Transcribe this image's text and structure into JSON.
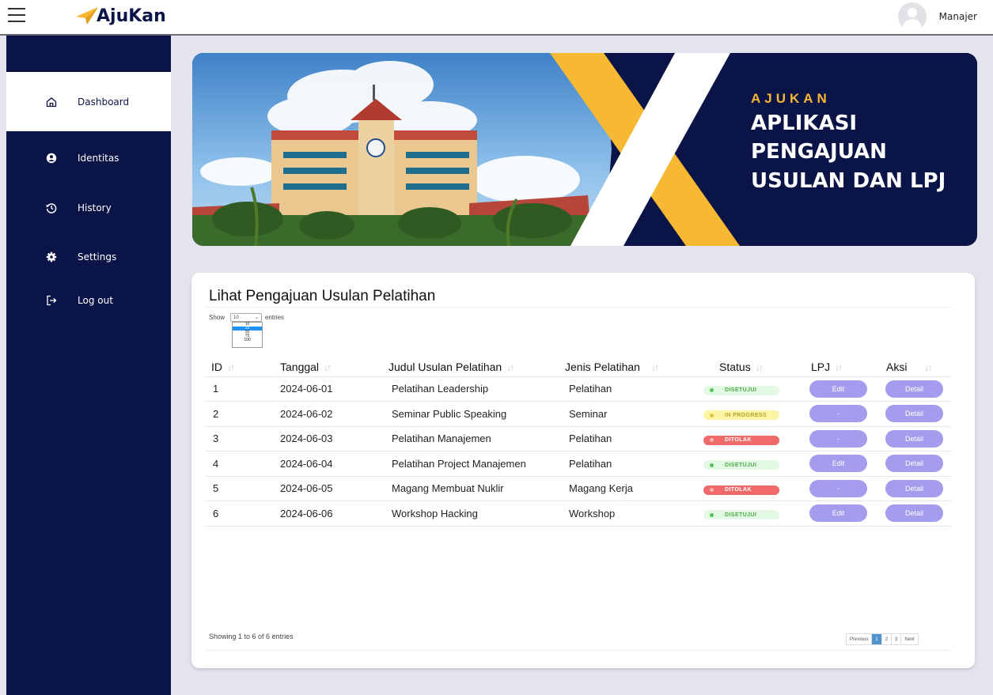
{
  "app": {
    "brand": "AjuKan",
    "user_name": "Manajer"
  },
  "colors": {
    "navy": "#0b1446",
    "accent_yellow": "#f7b834",
    "button_purple": "#a49dee"
  },
  "sidebar": {
    "items": [
      {
        "label": "Dashboard",
        "icon": "home-icon"
      },
      {
        "label": "Identitas",
        "icon": "user-circle-icon"
      },
      {
        "label": "History",
        "icon": "history-icon"
      },
      {
        "label": "Settings",
        "icon": "gear-icon"
      },
      {
        "label": "Log out",
        "icon": "logout-icon"
      }
    ]
  },
  "banner": {
    "kicker": "AJUKAN",
    "line1": "APLIKASI",
    "line2": "PENGAJUAN",
    "line3": "USULAN DAN LPJ"
  },
  "card": {
    "title": "Lihat Pengajuan Usulan Pelatihan",
    "show_label": "Show",
    "entries_label": "entries",
    "page_size": "10",
    "page_size_options": [
      "10",
      "25",
      "50",
      "75",
      "100"
    ],
    "showing_text": "Showing 1 to 6 of 6 entries"
  },
  "table": {
    "headers": [
      "ID",
      "Tanggal",
      "Judul Usulan Pelatihan",
      "Jenis Pelatihan",
      "Status",
      "LPJ",
      "Aksi"
    ],
    "rows": [
      {
        "id": "1",
        "date": "2024-06-01",
        "title": "Pelatihan Leadership",
        "type": "Pelatihan",
        "status": "DISETUJUI",
        "lpj": "Edit",
        "action": "Detail"
      },
      {
        "id": "2",
        "date": "2024-06-02",
        "title": "Seminar Public Speaking",
        "type": "Seminar",
        "status": "IN PROGRESS",
        "lpj": "-",
        "action": "Detail"
      },
      {
        "id": "3",
        "date": "2024-06-03",
        "title": "Pelatihan Manajemen",
        "type": "Pelatihan",
        "status": "DITOLAK",
        "lpj": "-",
        "action": "Detail"
      },
      {
        "id": "4",
        "date": "2024-06-04",
        "title": "Pelatihan Project Manajemen",
        "type": "Pelatihan",
        "status": "DISETUJUI",
        "lpj": "Edit",
        "action": "Detail"
      },
      {
        "id": "5",
        "date": "2024-06-05",
        "title": "Magang Membuat Nuklir",
        "type": "Magang Kerja",
        "status": "DITOLAK",
        "lpj": "-",
        "action": "Detail"
      },
      {
        "id": "6",
        "date": "2024-06-06",
        "title": "Workshop Hacking",
        "type": "Workshop",
        "status": "DISETUJUI",
        "lpj": "Edit",
        "action": "Detail"
      }
    ]
  },
  "pagination": {
    "previous": "Previous",
    "pages": [
      "1",
      "2",
      "3"
    ],
    "current": "1",
    "next": "Next"
  }
}
